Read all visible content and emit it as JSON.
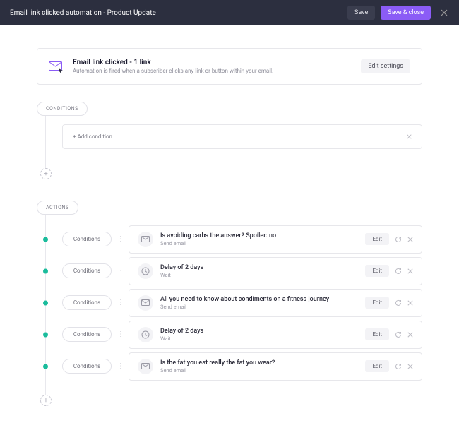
{
  "header": {
    "title": "Email link clicked automation - Product Update",
    "save": "Save",
    "save_close": "Save & close"
  },
  "trigger": {
    "title": "Email link clicked - 1 link",
    "subtitle": "Automation is fired when a subscriber clicks any link or button within your email.",
    "edit": "Edit settings"
  },
  "labels": {
    "conditions": "CONDITIONS",
    "actions": "ACTIONS",
    "add_condition": "+ Add condition",
    "cond_pill": "Conditions",
    "edit": "Edit"
  },
  "actions": [
    {
      "kind": "email",
      "title": "Is avoiding carbs the answer? Spoiler: no",
      "sub": "Send email"
    },
    {
      "kind": "wait",
      "title": "Delay of 2 days",
      "sub": "Wait"
    },
    {
      "kind": "email",
      "title": "All you need to know about condiments on a fitness journey",
      "sub": "Send email"
    },
    {
      "kind": "wait",
      "title": "Delay of 2 days",
      "sub": "Wait"
    },
    {
      "kind": "email",
      "title": "Is the fat you eat really the fat you wear?",
      "sub": "Send email"
    }
  ]
}
